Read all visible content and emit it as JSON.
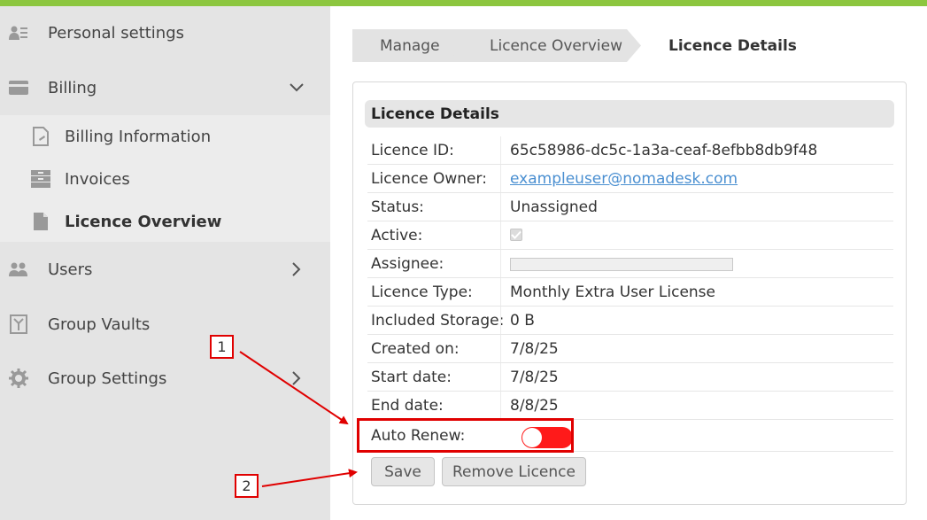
{
  "colors": {
    "accent": "#8cc63f",
    "toggle_off": "#ff1a1a",
    "annotation": "#e00000",
    "link": "#4a8fd1"
  },
  "sidebar": {
    "items": [
      {
        "label": "Personal settings",
        "icon": "person-list-icon"
      },
      {
        "label": "Billing",
        "icon": "card-icon",
        "expanded": true
      },
      {
        "label": "Users",
        "icon": "users-icon"
      },
      {
        "label": "Group Vaults",
        "icon": "vault-icon"
      },
      {
        "label": "Group Settings",
        "icon": "gear-icon"
      }
    ],
    "billing_sub": [
      {
        "label": "Billing Information",
        "icon": "document-edit-icon"
      },
      {
        "label": "Invoices",
        "icon": "drawer-icon"
      },
      {
        "label": "Licence Overview",
        "icon": "document-icon",
        "active": true
      }
    ]
  },
  "breadcrumb": {
    "manage": "Manage",
    "overview": "Licence Overview",
    "current": "Licence Details"
  },
  "panel": {
    "title": "Licence Details",
    "rows": {
      "licence_id": {
        "label": "Licence ID:",
        "value": "65c58986-dc5c-1a3a-ceaf-8efbb8db9f48"
      },
      "owner": {
        "label": "Licence Owner:",
        "value": "exampleuser@nomadesk.com"
      },
      "status": {
        "label": "Status:",
        "value": "Unassigned"
      },
      "active": {
        "label": "Active:",
        "checked": true
      },
      "assignee": {
        "label": "Assignee:",
        "value": ""
      },
      "type": {
        "label": "Licence Type:",
        "value": "Monthly Extra User License"
      },
      "storage": {
        "label": "Included Storage:",
        "value": "0 B"
      },
      "created": {
        "label": "Created on:",
        "value": "7/8/25"
      },
      "start": {
        "label": "Start date:",
        "value": "7/8/25"
      },
      "end": {
        "label": "End date:",
        "value": "8/8/25"
      },
      "auto_renew": {
        "label": "Auto Renew:",
        "on": false
      }
    },
    "buttons": {
      "save": "Save",
      "remove": "Remove Licence"
    }
  },
  "annotations": {
    "one": "1",
    "two": "2"
  }
}
